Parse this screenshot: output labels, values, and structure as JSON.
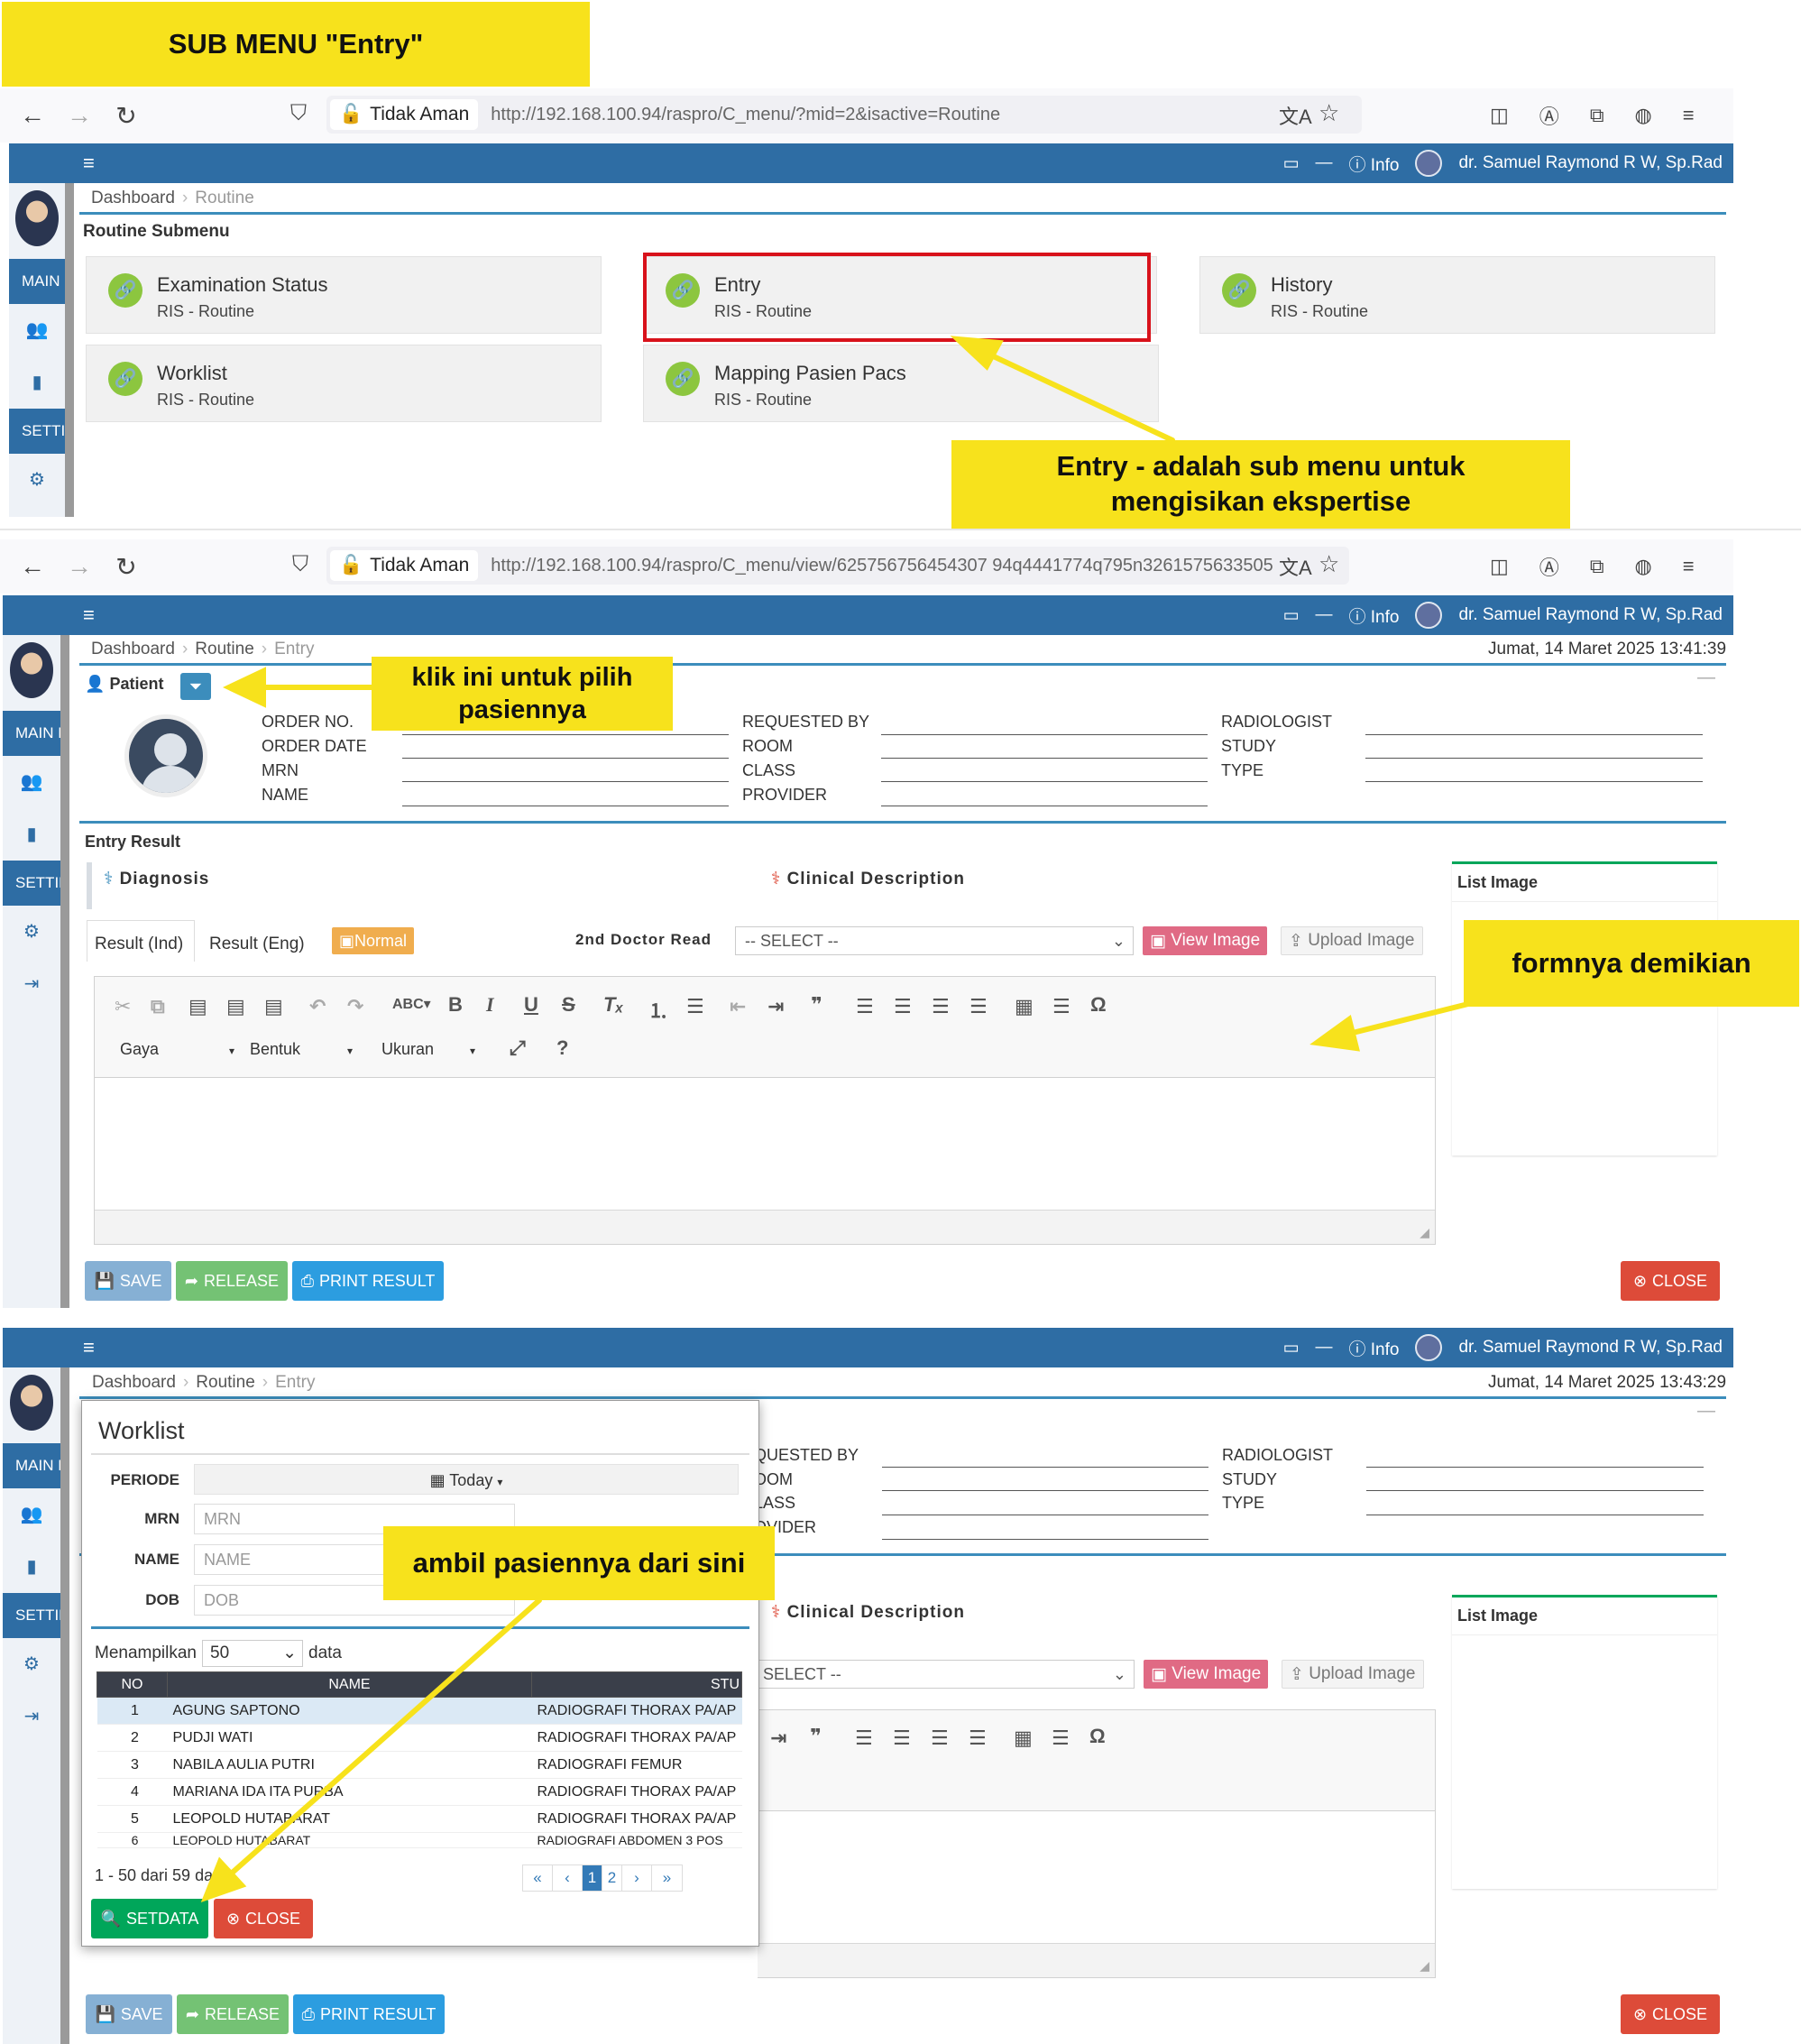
{
  "callouts": {
    "title": "SUB MENU \"Entry\"",
    "entry_desc_1": "Entry - adalah sub menu untuk",
    "entry_desc_2": "mengisikan ekspertise",
    "pick_patient_1": "klik ini untuk pilih",
    "pick_patient_2": "pasiennya",
    "form_desc": "formnya demikian",
    "take_patient": "ambil pasiennya dari sini"
  },
  "browser1": {
    "security": "Tidak Aman",
    "url": "http://192.168.100.94/raspro/C_menu/?mid=2&isactive=Routine"
  },
  "browser2": {
    "security": "Tidak Aman",
    "url": "http://192.168.100.94/raspro/C_menu/view/625756756454307 94q4441774q795n3261575633505"
  },
  "topbar": {
    "info": "Info",
    "user": "dr. Samuel Raymond R W, Sp.Rad"
  },
  "sidebar": {
    "main": "MAIN N",
    "settings": "SETTIN"
  },
  "screen1": {
    "breadcrumb": [
      "Dashboard",
      "Routine"
    ],
    "panel_title": "Routine Submenu",
    "cards": [
      {
        "title": "Examination Status",
        "sub": "RIS - Routine"
      },
      {
        "title": "Entry",
        "sub": "RIS - Routine"
      },
      {
        "title": "History",
        "sub": "RIS - Routine"
      },
      {
        "title": "Worklist",
        "sub": "RIS - Routine"
      },
      {
        "title": "Mapping Pasien Pacs",
        "sub": "RIS - Routine"
      }
    ]
  },
  "screen2": {
    "breadcrumb": [
      "Dashboard",
      "Routine",
      "Entry"
    ],
    "datetime": "Jumat, 14 Maret 2025 13:41:39",
    "patient_label": "Patient",
    "fields_left": [
      "ORDER NO.",
      "ORDER DATE",
      "MRN",
      "NAME"
    ],
    "fields_mid": [
      "REQUESTED BY",
      "ROOM",
      "CLASS",
      "PROVIDER"
    ],
    "fields_right": [
      "RADIOLOGIST",
      "STUDY",
      "TYPE"
    ],
    "entry_result": "Entry Result",
    "diagnosis": "Diagnosis",
    "clinical": "Clinical Description",
    "list_image": "List Image",
    "tab_ind": "Result (Ind)",
    "tab_eng": "Result (Eng)",
    "normal": "Normal",
    "second_doctor": "2nd Doctor Read",
    "select": "-- SELECT --",
    "view_image": "View Image",
    "upload_image": "Upload Image",
    "gaya": "Gaya",
    "bentuk": "Bentuk",
    "ukuran": "Ukuran",
    "save": "SAVE",
    "release": "RELEASE",
    "print": "PRINT RESULT",
    "close": "CLOSE"
  },
  "screen3": {
    "breadcrumb": [
      "Dashboard",
      "Routine",
      "Entry"
    ],
    "datetime": "Jumat, 14 Maret 2025 13:43:29",
    "fields_mid": [
      "QUESTED BY",
      "OOM",
      "LASS",
      "OVIDER"
    ],
    "fields_right": [
      "RADIOLOGIST",
      "STUDY",
      "TYPE"
    ],
    "clinical": "Clinical Description",
    "list_image": "List Image",
    "select": "SELECT --",
    "view_image": "View Image",
    "upload_image": "Upload Image",
    "save": "SAVE",
    "release": "RELEASE",
    "print": "PRINT RESULT",
    "close": "CLOSE"
  },
  "worklist": {
    "title": "Worklist",
    "periode_label": "PERIODE",
    "periode_value": "Today",
    "mrn_label": "MRN",
    "mrn_placeholder": "MRN",
    "name_label": "NAME",
    "name_placeholder": "NAME",
    "dob_label": "DOB",
    "dob_placeholder": "DOB",
    "show_pre": "Menampilkan",
    "show_value": "50",
    "show_post": "data",
    "columns": [
      "NO",
      "NAME",
      "STU"
    ],
    "rows": [
      [
        "1",
        "AGUNG SAPTONO",
        "RADIOGRAFI THORAX PA/AP"
      ],
      [
        "2",
        "PUDJI WATI",
        "RADIOGRAFI THORAX PA/AP"
      ],
      [
        "3",
        "NABILA AULIA PUTRI",
        "RADIOGRAFI FEMUR"
      ],
      [
        "4",
        "MARIANA IDA ITA PURBA",
        "RADIOGRAFI THORAX PA/AP"
      ],
      [
        "5",
        "LEOPOLD HUTABARAT",
        "RADIOGRAFI THORAX PA/AP"
      ],
      [
        "6",
        "LEOPOLD HUTABARAT",
        "RADIOGRAFI ABDOMEN 3 POS"
      ]
    ],
    "summary": "1 - 50 dari 59 data",
    "pages": [
      "«",
      "‹",
      "1",
      "2",
      "›",
      "»"
    ],
    "setdata": "SETDATA",
    "close": "CLOSE"
  }
}
